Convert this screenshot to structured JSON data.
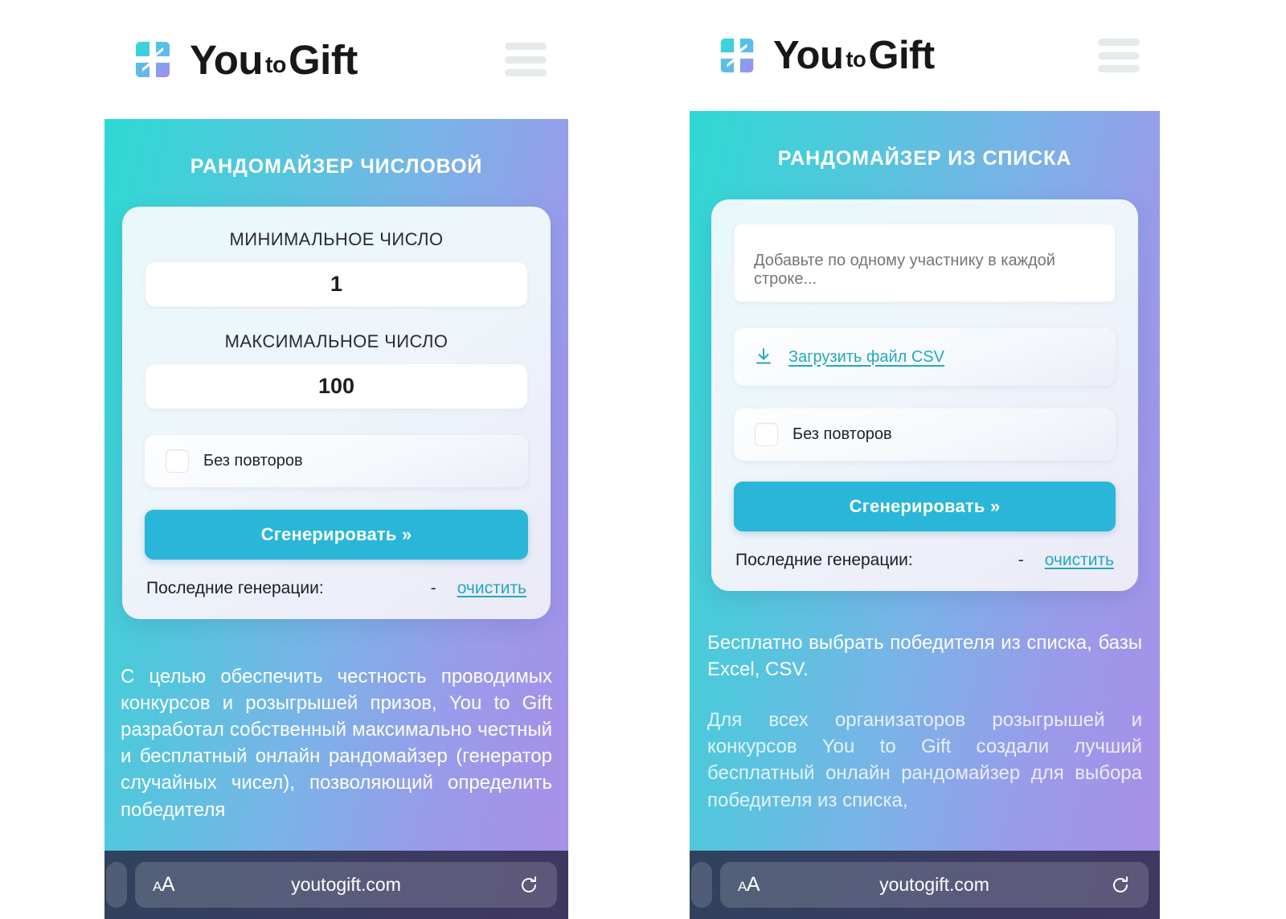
{
  "brand": {
    "name_part1": "You",
    "name_small": "to",
    "name_part2": "Gift",
    "logo_icon": "youtogift-logo-icon",
    "menu_icon": "hamburger-menu-icon"
  },
  "colors": {
    "gradient_start": "#2ed9d4",
    "gradient_end": "#a98ee8",
    "button": "#29b6d8",
    "link": "#22a9be",
    "browser_bar": "#282442"
  },
  "phones": [
    {
      "id": "number-randomizer",
      "section_title": "РАНДОМАЙЗЕР ЧИСЛОВОЙ",
      "fields": {
        "min_label": "МИНИМАЛЬНОЕ ЧИСЛО",
        "min_value": "1",
        "max_label": "МАКСИМАЛЬНОЕ ЧИСЛО",
        "max_value": "100"
      },
      "checkbox_label": "Без повторов",
      "checkbox_checked": false,
      "generate_label": "Сгенерировать »",
      "history": {
        "label": "Последние генерации:",
        "dash": "-",
        "clear_label": "очистить"
      },
      "copy": [
        "С целью обеспечить честность проводимых конкурсов и розыгрышей призов, You to Gift разработал собственный максимально честный и бесплатный онлайн рандомайзер (генератор случайных чисел), позволяющий определить победителя"
      ],
      "browser": {
        "text_size_small": "A",
        "text_size_big": "A",
        "url": "youtogift.com",
        "reload_icon": "reload-icon"
      }
    },
    {
      "id": "list-randomizer",
      "section_title": "РАНДОМАЙЗЕР ИЗ СПИСКА",
      "textarea_placeholder": "Добавьте по одному участнику в каждой строке...",
      "textarea_value": "",
      "upload": {
        "icon": "download-file-icon",
        "label": "Загрузить файл CSV"
      },
      "checkbox_label": "Без повторов",
      "checkbox_checked": false,
      "generate_label": "Сгенерировать »",
      "history": {
        "label": "Последние генерации:",
        "dash": "-",
        "clear_label": "очистить"
      },
      "copy": [
        "Бесплатно выбрать победителя из списка, базы Excel, CSV.",
        "Для всех организаторов розыгрышей и конкурсов You to Gift создали лучший бесплатный онлайн рандомайзер для выбора победителя из списка,"
      ],
      "browser": {
        "text_size_small": "A",
        "text_size_big": "A",
        "url": "youtogift.com",
        "reload_icon": "reload-icon"
      }
    }
  ]
}
